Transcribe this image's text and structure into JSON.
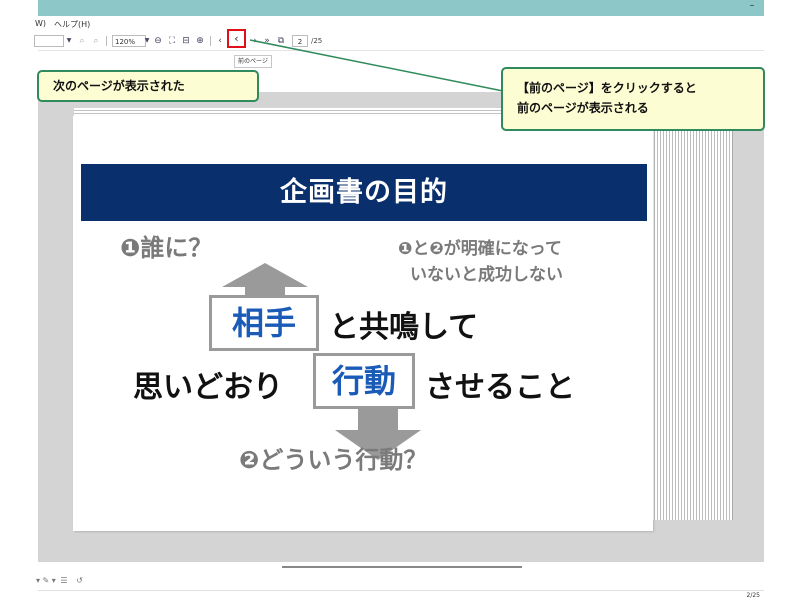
{
  "menu": {
    "partial_item": "W)",
    "help": "ヘルプ(H)"
  },
  "toolbar": {
    "zoom_value": "120%",
    "page_current": "2",
    "page_total": "/25",
    "prev_tooltip": "前のページ"
  },
  "slide": {
    "title": "企画書の目的",
    "who": "❶誰に？",
    "note_line1": "❶と❷が明確になって",
    "note_line2": "いないと成功しない",
    "partner": "相手",
    "line1_rest": "と共鳴して",
    "line2_pre": "思いどおり",
    "action": "行動",
    "line2_post": "させること",
    "what_action": "❷どういう行動？"
  },
  "status": {
    "page": "2/25"
  },
  "callouts": {
    "left": "次のページが表示された",
    "right_line1": "【前のページ】をクリックすると",
    "right_line2": "前のページが表示される"
  },
  "colors": {
    "title_bar": "#8ec7c7",
    "slide_header": "#0a2f6d",
    "highlight": "#e0101a",
    "callout_border": "#2f8a5c",
    "callout_bg": "#fdfdd3",
    "accent_blue": "#1a5bb8"
  }
}
